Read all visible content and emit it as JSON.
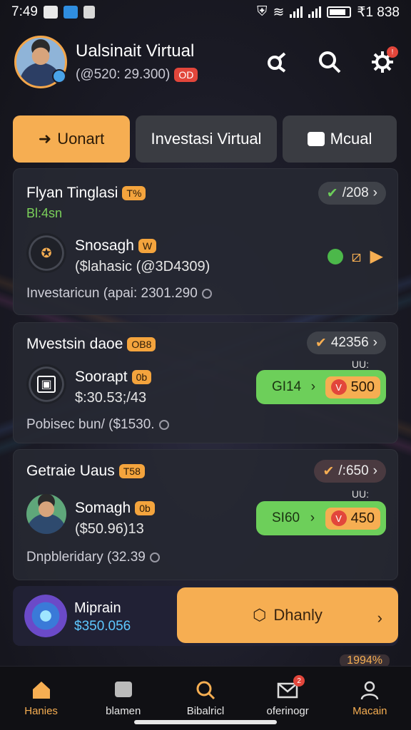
{
  "status_bar": {
    "time": "7:49",
    "right_text": "₹1 838"
  },
  "header": {
    "name": "Ualsinait Virtual",
    "subtitle": "(@520: 29.300)",
    "tag": "OD"
  },
  "tabs": [
    {
      "label": "Uonart",
      "active": true
    },
    {
      "label": "Investasi Virtual",
      "active": false
    },
    {
      "label": "Mcual",
      "active": false
    }
  ],
  "cards": [
    {
      "title": "Flyan Tinglasi",
      "badge": "T%",
      "subtitle": "Bl:4sn",
      "pill": "/208",
      "row_name": "Snosagh",
      "row_badge": "W",
      "row_value": "($lahasic (@3D4309)",
      "footer": "Investaricun (apai: 2301.290"
    },
    {
      "title": "Mvestsin daoe",
      "badge": "OB8",
      "pill": "42356",
      "row_name": "Soorapt",
      "row_badge": "0b",
      "row_value": "$:30.53;/43",
      "footer": "Pobisec bun/ ($1530.",
      "buy_label": "GI14",
      "buy_amount": "500",
      "buy_note": "UU:"
    },
    {
      "title": "Getraie Uaus",
      "badge": "T58",
      "pill": "/:650",
      "row_name": "Somagh",
      "row_badge": "0b",
      "row_value": "($50.96)13",
      "footer": "Dnpbleridary (32.39",
      "buy_label": "SI60",
      "buy_amount": "450",
      "buy_note": "UU:"
    }
  ],
  "promo": {
    "title": "Miprain",
    "value": "$350.056",
    "button": "Dhanly",
    "peek": "1994%"
  },
  "bottom_nav": [
    {
      "label": "Hanies",
      "icon": "home-icon"
    },
    {
      "label": "blamen",
      "icon": "chat-icon"
    },
    {
      "label": "Bibalricl",
      "icon": "search-icon"
    },
    {
      "label": "oferinogr",
      "icon": "mail-icon",
      "badge": "2"
    },
    {
      "label": "Macain",
      "icon": "profile-icon"
    }
  ],
  "colors": {
    "accent": "#f6ae52",
    "green": "#6dcf5a",
    "red": "#e2463b",
    "card": "#262832"
  }
}
